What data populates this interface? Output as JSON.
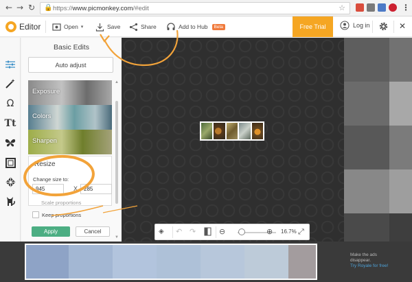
{
  "browser": {
    "url_prefix": "https://",
    "url_host": "www.picmonkey.com",
    "url_path": "/#edit",
    "back_glyph": "←",
    "forward_glyph": "→",
    "reload_glyph": "↻",
    "lock_glyph": "🔒",
    "star_glyph": "☆"
  },
  "app": {
    "brand": "Editor",
    "open_label": "Open",
    "save_label": "Save",
    "share_label": "Share",
    "add_to_hub_label": "Add to Hub",
    "beta_label": "Beta",
    "free_trial_label": "Free Trial",
    "login_label": "Log in"
  },
  "panel": {
    "title": "Basic Edits",
    "auto_adjust_label": "Auto adjust",
    "tiles": [
      {
        "label": "Exposure"
      },
      {
        "label": "Colors"
      },
      {
        "label": "Sharpen"
      }
    ],
    "resize": {
      "heading": "Resize",
      "change_label": "Change size to:",
      "width_value": "945",
      "x_label": "X",
      "height_value": "285",
      "faded_label": "Scale proportions",
      "keep_label": "Keep proportions",
      "apply_label": "Apply",
      "cancel_label": "Cancel"
    }
  },
  "rail": {
    "icons": [
      "sliders-icon",
      "magic-wand-icon",
      "omega-icon",
      "text-icon",
      "butterfly-icon",
      "frame-icon",
      "texture-icon",
      "cat-icon"
    ]
  },
  "zoom": {
    "value": "16.7%",
    "minus_glyph": "⊖",
    "plus_glyph": "⊕",
    "undo_glyph": "↶",
    "redo_glyph": "↷",
    "fit_glyph": "⤢",
    "slider_level": 0.1
  },
  "ad": {
    "line1": "Make the ads",
    "line2": "disappear.",
    "link": "Try Royale for free!"
  },
  "colors": {
    "accent_orange": "#f5a623",
    "apply_green": "#4cae83",
    "beta_orange": "#f07a3c",
    "link_blue": "#4ea2d8",
    "annotation_orange": "#f2a33a"
  }
}
